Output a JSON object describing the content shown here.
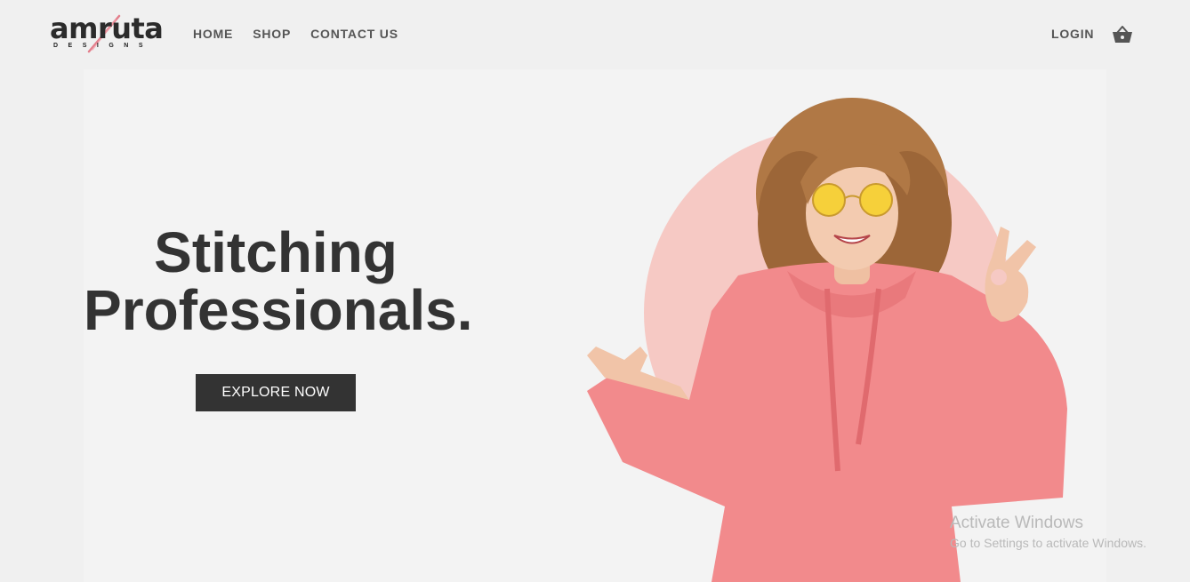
{
  "brand": {
    "name": "amruta",
    "tagline": "DESIGNS"
  },
  "nav": {
    "items": [
      {
        "label": "HOME"
      },
      {
        "label": "SHOP"
      },
      {
        "label": "CONTACT US"
      }
    ]
  },
  "header": {
    "login_label": "LOGIN",
    "cart_icon": "basket-icon"
  },
  "hero": {
    "headline_line1": "Stitching",
    "headline_line2": "Professionals.",
    "cta_label": "EXPLORE NOW",
    "image_subject": "smiling woman in pink hoodie pointing left and making OK sign",
    "accent_circle_color": "#f6c9c4",
    "hoodie_color": "#f28a8c"
  },
  "watermark": {
    "title": "Activate Windows",
    "subtitle": "Go to Settings to activate Windows."
  },
  "colors": {
    "background": "#f0f0f0",
    "text": "#333333",
    "button_bg": "#333333",
    "button_text": "#ffffff",
    "nav_text": "#555555"
  }
}
